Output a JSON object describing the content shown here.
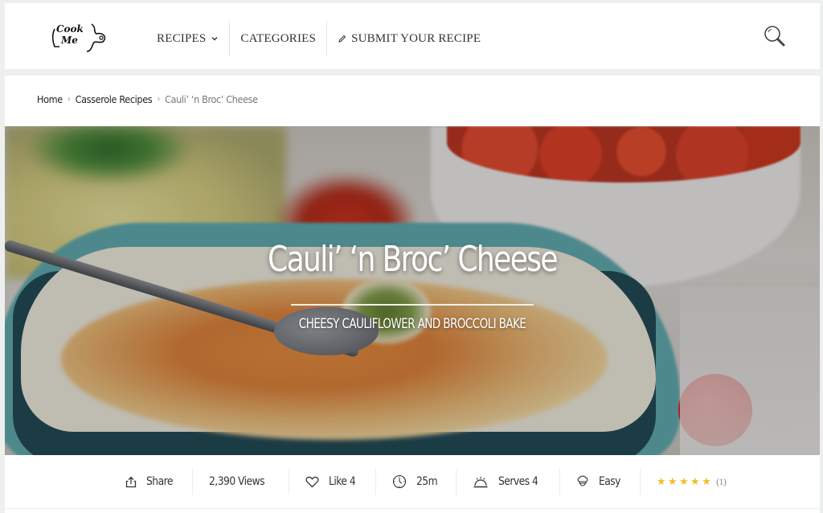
{
  "header": {
    "logo_text_top": "Cook",
    "logo_text_bottom": "Me",
    "nav": [
      {
        "label": "RECIPES",
        "icon": "chevron-down-icon"
      },
      {
        "label": "CATEGORIES"
      },
      {
        "label": "SUBMIT YOUR RECIPE",
        "icon": "pencil-icon"
      }
    ],
    "search_icon": "search-icon"
  },
  "breadcrumb": {
    "items": [
      "Home",
      "Casserole Recipes"
    ],
    "separator": "›",
    "current": "Cauli’ ‘n Broc’ Cheese"
  },
  "hero": {
    "title": "Cauli’ ‘n Broc’ Cheese",
    "subtitle": "CHEESY CAULIFLOWER AND BROCCOLI BAKE"
  },
  "meta": {
    "share": {
      "label": "Share",
      "icon": "share-icon"
    },
    "views": {
      "label": "2,390 Views"
    },
    "like": {
      "label": "Like 4",
      "icon": "heart-icon"
    },
    "time": {
      "label": "25m",
      "icon": "clock-icon"
    },
    "serves": {
      "label": "Serves 4",
      "icon": "cloche-icon"
    },
    "difficulty": {
      "label": "Easy",
      "icon": "chef-hat-icon"
    },
    "rating": {
      "stars": 5,
      "max": 5,
      "count": "(1)",
      "star_color": "#f0be2a"
    }
  }
}
